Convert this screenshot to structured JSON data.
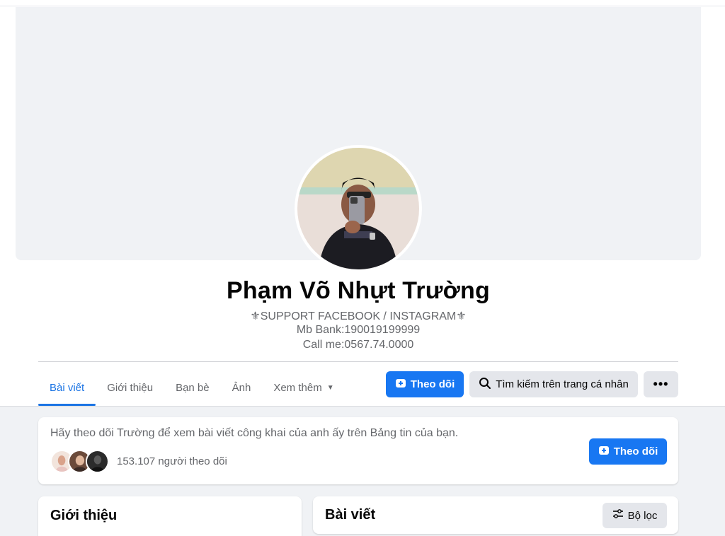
{
  "profile": {
    "name": "Phạm Võ Nhựt Trường",
    "bio_line1": "⚜SUPPORT FACEBOOK / INSTAGRAM⚜",
    "bio_line2": "Mb Bank:190019199999",
    "bio_line3": "Call me:0567.74.0000"
  },
  "tabs": [
    {
      "label": "Bài viết",
      "active": true
    },
    {
      "label": "Giới thiệu",
      "active": false
    },
    {
      "label": "Bạn bè",
      "active": false
    },
    {
      "label": "Ảnh",
      "active": false
    },
    {
      "label": "Xem thêm",
      "active": false
    }
  ],
  "actions": {
    "follow_label": "Theo dõi",
    "search_label": "Tìm kiếm trên trang cá nhân",
    "more_label": "•••"
  },
  "follow_card": {
    "prompt": "Hãy theo dõi Trường để xem bài viết công khai của anh ấy trên Bảng tin của bạn.",
    "followers": "153.107 người theo dõi",
    "button_label": "Theo dõi"
  },
  "intro_card": {
    "title": "Giới thiệu"
  },
  "posts_card": {
    "title": "Bài viết",
    "filter_label": "Bộ lọc"
  },
  "colors": {
    "accent": "#1877f2",
    "tab_active": "#1b74e4",
    "background": "#f0f2f5"
  },
  "icons": {
    "follow": "add-user-icon",
    "search": "search-icon",
    "more": "more-dots-icon",
    "filter": "filter-icon",
    "caret": "caret-down-icon"
  }
}
